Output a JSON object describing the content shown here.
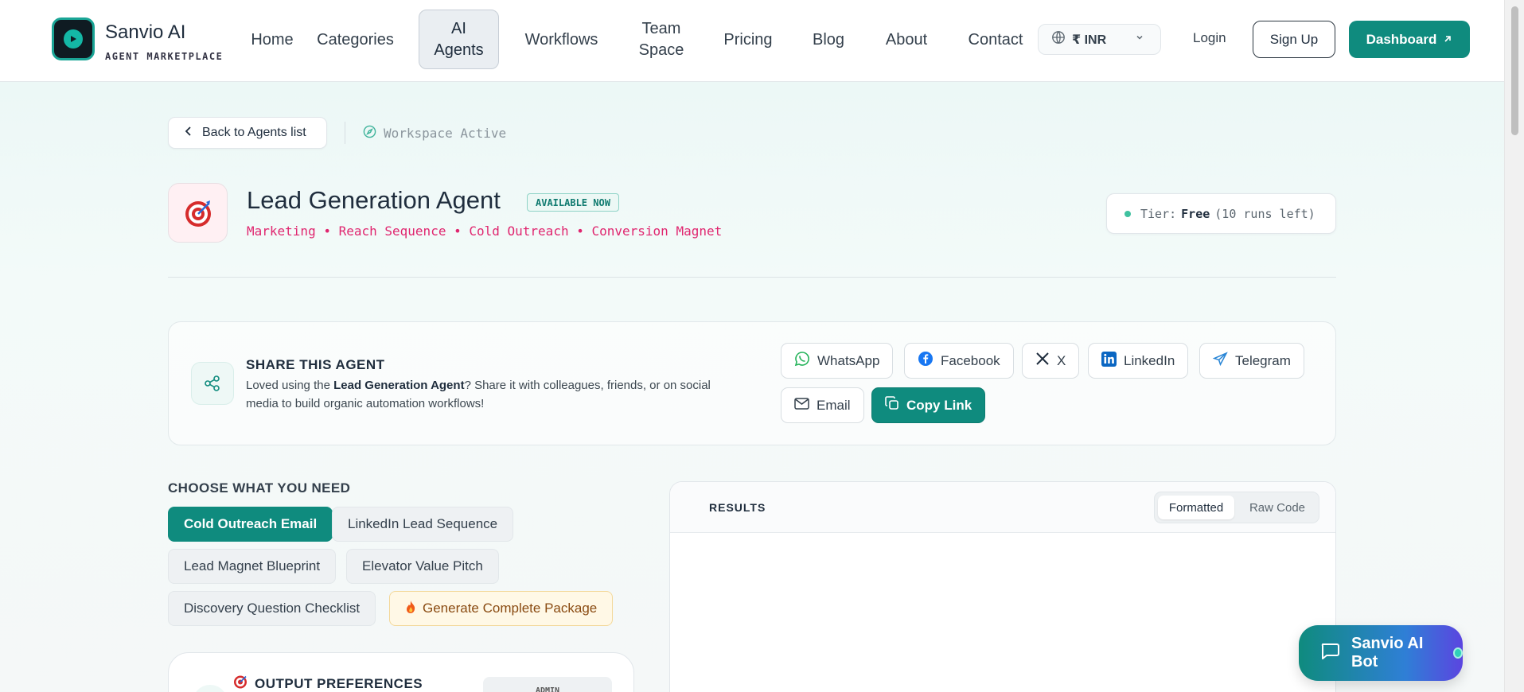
{
  "brand": {
    "name": "Sanvio AI",
    "tagline": "AGENT MARKETPLACE"
  },
  "nav": {
    "home": "Home",
    "categories": "Categories",
    "ai_agents_line1": "AI",
    "ai_agents_line2": "Agents",
    "workflows": "Workflows",
    "team_line1": "Team",
    "team_line2": "Space",
    "pricing": "Pricing",
    "blog": "Blog",
    "about": "About",
    "contact": "Contact"
  },
  "currency": {
    "selected": "₹ INR"
  },
  "auth": {
    "login": "Login",
    "signup": "Sign Up",
    "dashboard": "Dashboard"
  },
  "breadcrumb": {
    "back": "Back to Agents list",
    "workspace": "Workspace Active"
  },
  "agent": {
    "title": "Lead Generation Agent",
    "status": "AVAILABLE NOW",
    "tags": "Marketing • Reach Sequence • Cold Outreach • Conversion Magnet",
    "tier_label": "Tier:",
    "tier_value": "Free",
    "tier_runs": "(10 runs left)"
  },
  "share": {
    "title": "SHARE THIS AGENT",
    "desc_pre": "Loved using the ",
    "desc_bold": "Lead Generation Agent",
    "desc_post": "? Share it with colleagues, friends, or on social media to build organic automation workflows!",
    "buttons": {
      "whatsapp": "WhatsApp",
      "facebook": "Facebook",
      "x": "X",
      "linkedin": "LinkedIn",
      "telegram": "Telegram",
      "email": "Email",
      "copy": "Copy Link"
    }
  },
  "choose": {
    "label": "CHOOSE WHAT YOU NEED",
    "options": {
      "cold_email": "Cold Outreach Email",
      "linkedin_seq": "LinkedIn Lead Sequence",
      "lead_magnet": "Lead Magnet Blueprint",
      "elevator": "Elevator Value Pitch",
      "discovery": "Discovery Question Checklist",
      "complete": "Generate Complete Package"
    }
  },
  "preferences": {
    "title": "OUTPUT PREFERENCES",
    "badge": "ADMIN"
  },
  "results": {
    "title": "RESULTS",
    "tab_formatted": "Formatted",
    "tab_raw": "Raw Code"
  },
  "bot": {
    "label": "Sanvio AI Bot"
  },
  "colors": {
    "accent": "#0f8b7e",
    "tag_pink": "#e0266f",
    "status_green": "#3fc19f"
  }
}
